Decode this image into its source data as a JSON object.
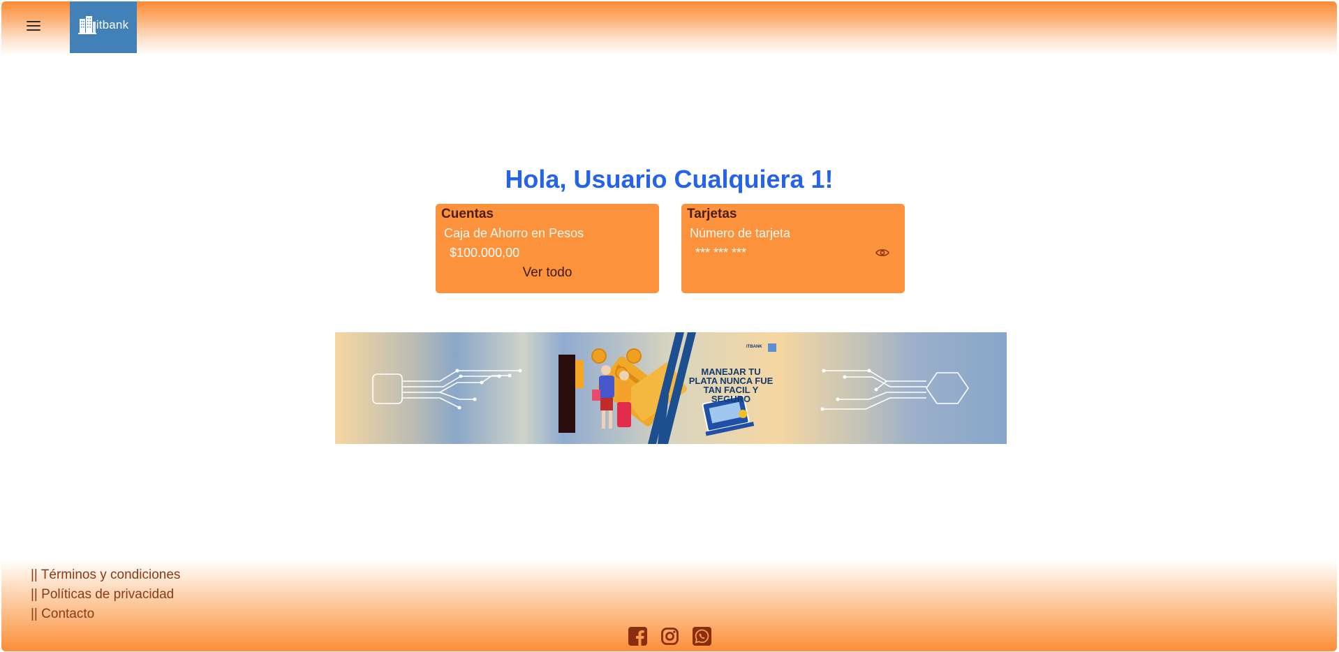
{
  "header": {
    "menu_icon": "hamburger-icon",
    "logo_text": "itbank",
    "logo_icon": "building-icon"
  },
  "greeting": "Hola, Usuario Cualquiera 1!",
  "cards": {
    "accounts": {
      "title": "Cuentas",
      "account_name": "Caja de Ahorro en Pesos",
      "balance": "$100.000,00",
      "view_all": "Ver todo"
    },
    "cards": {
      "title": "Tarjetas",
      "label": "Número de tarjeta",
      "masked_number": "*** *** ***",
      "toggle_icon": "eye-icon"
    }
  },
  "banner": {
    "text": "MANEJAR TU PLATA NUNCA FUE TAN FACIL Y SEGURO",
    "brand": "ITBANK"
  },
  "footer": {
    "links": [
      "|| Términos y condiciones",
      "|| Políticas de privacidad",
      "|| Contacto"
    ],
    "social_icons": [
      "facebook-icon",
      "instagram-icon",
      "whatsapp-icon"
    ]
  },
  "colors": {
    "accent": "#fb8c36",
    "card": "#fd923c",
    "greeting": "#2563eb",
    "logo_bg": "#4280b8",
    "footer_link": "#8a3a16"
  }
}
